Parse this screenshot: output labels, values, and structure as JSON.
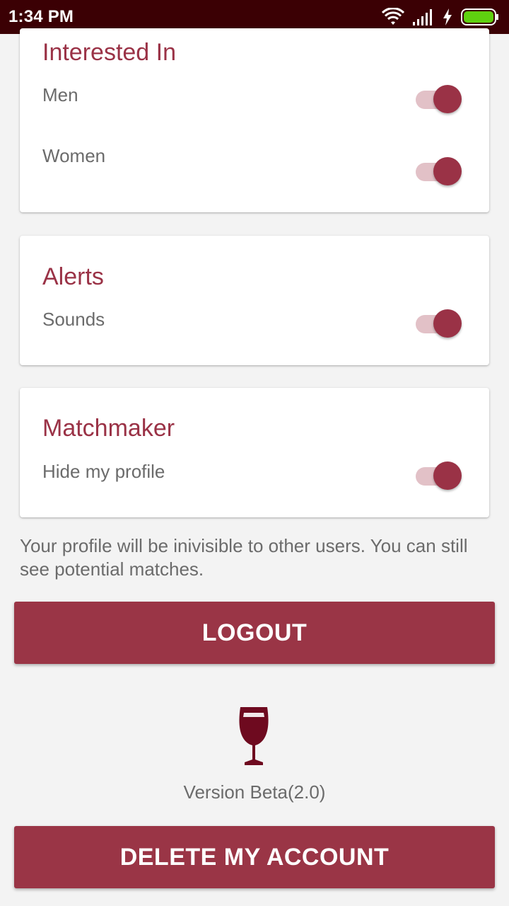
{
  "status_bar": {
    "time": "1:34 PM"
  },
  "interested_in": {
    "title": "Interested In",
    "men_label": "Men",
    "men_enabled": true,
    "women_label": "Women",
    "women_enabled": true
  },
  "alerts": {
    "title": "Alerts",
    "sounds_label": "Sounds",
    "sounds_enabled": true
  },
  "matchmaker": {
    "title": "Matchmaker",
    "hide_profile_label": "Hide my profile",
    "hide_profile_enabled": true,
    "hint": "Your profile will be inivisible to other users. You can still see potential matches."
  },
  "actions": {
    "logout_label": "LOGOUT",
    "delete_label": "DELETE MY ACCOUNT"
  },
  "footer": {
    "logo_icon": "wine-glass-icon",
    "version": "Version Beta(2.0)"
  },
  "colors": {
    "accent": "#9a3246",
    "status_bar": "#3b0004",
    "toggle_track": "#e2c1c7",
    "battery": "#5fd10f"
  }
}
